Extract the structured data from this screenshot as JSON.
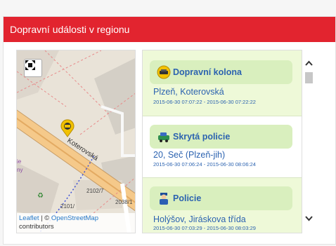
{
  "panel": {
    "title": "Dopravní události v regionu"
  },
  "map": {
    "street": "Koterovská",
    "labels": [
      "2102/7",
      "2101/",
      "2038/1",
      "ova"
    ],
    "edge_text": [
      "ie",
      "ny"
    ],
    "attribution": {
      "leaflet": "Leaflet",
      "separator": " | © ",
      "osm": "OpenStreetMap",
      "contributors": "contributors"
    }
  },
  "events": [
    {
      "icon": "traffic-jam-icon",
      "title": "Dopravní kolona",
      "location": "Plzeň, Koterovská",
      "time": "2015-06-30 07:07:22 - 2015-06-30 07:22:22"
    },
    {
      "icon": "police-car-icon",
      "title": "Skrytá policie",
      "location": "20, Seč (Plzeň-jih)",
      "time": "2015-06-30 07:06:24 - 2015-06-30 08:06:24"
    },
    {
      "icon": "policeman-icon",
      "title": "Policie",
      "location": "Holýšov, Jiráskova třída",
      "time": "2015-06-30 07:03:29 - 2015-06-30 08:03:29"
    }
  ],
  "colors": {
    "header": "#e2242f",
    "item_bg": "#eef9d8",
    "pill_bg": "#d9efbe",
    "text_link": "#2c63b0"
  }
}
